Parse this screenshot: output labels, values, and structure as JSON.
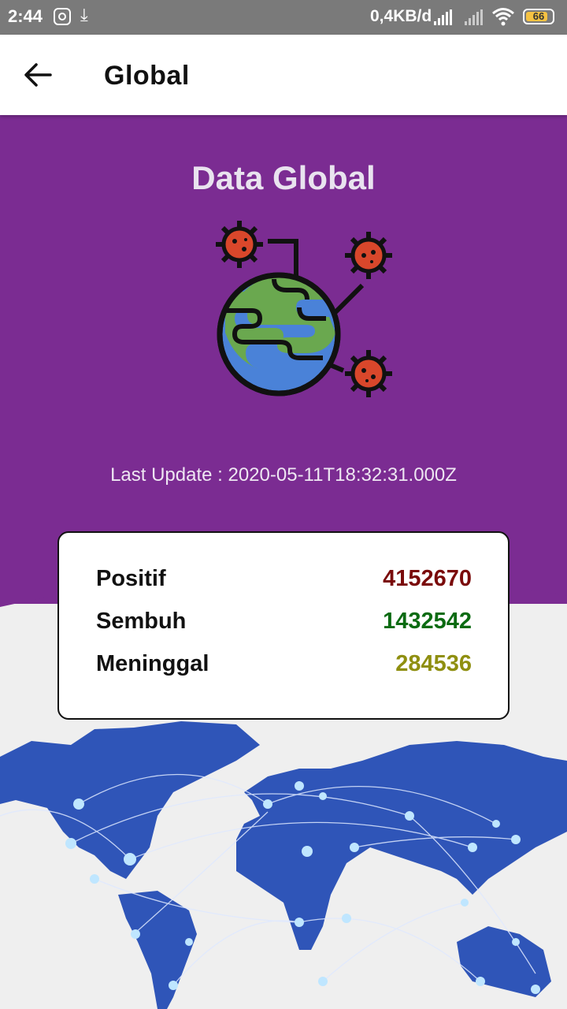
{
  "status_bar": {
    "time": "2:44",
    "network_speed": "0,4KB/d",
    "battery": "66",
    "icons": [
      "instagram-icon",
      "download-icon",
      "signal-icon",
      "signal-no-service-icon",
      "wifi-icon",
      "battery-icon"
    ]
  },
  "app_bar": {
    "title": "Global",
    "back_icon": "arrow-left-icon"
  },
  "hero": {
    "title": "Data Global",
    "illustration": "globe-virus-icon",
    "last_update": "Last Update : 2020-05-11T18:32:31.000Z",
    "background_color": "#7b2c92"
  },
  "stats": {
    "positif": {
      "label": "Positif",
      "value": "4152670",
      "color": "#7a0a0a"
    },
    "sembuh": {
      "label": "Sembuh",
      "value": "1432542",
      "color": "#0b6b12"
    },
    "meninggal": {
      "label": "Meninggal",
      "value": "284536",
      "color": "#8f8f10"
    }
  },
  "footer_image": "world-map-network"
}
